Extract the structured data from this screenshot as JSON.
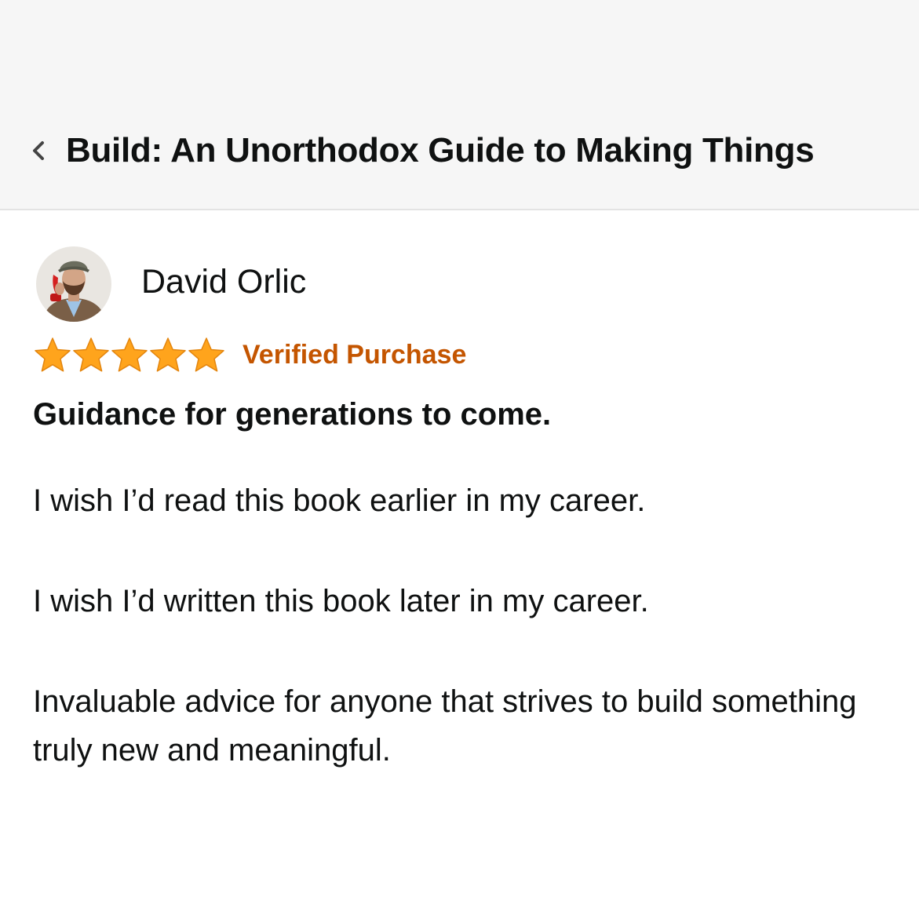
{
  "header": {
    "back_icon": "chevron-left-icon",
    "title": "Build: An Unorthodox Guide to Making Things"
  },
  "review": {
    "reviewer_name": "David Orlic",
    "avatar": "reviewer-avatar-photo",
    "rating": 5,
    "rating_max": 5,
    "star_color": "#ffa41c",
    "verified_label": "Verified Purchase",
    "verified_color": "#c45500",
    "title": "Guidance for generations to come.",
    "paragraphs": [
      "I wish I’d read this book earlier in my career.",
      "I wish I’d written this book later in my career.",
      "Invaluable advice for anyone that strives to build something truly new and meaningful."
    ]
  }
}
